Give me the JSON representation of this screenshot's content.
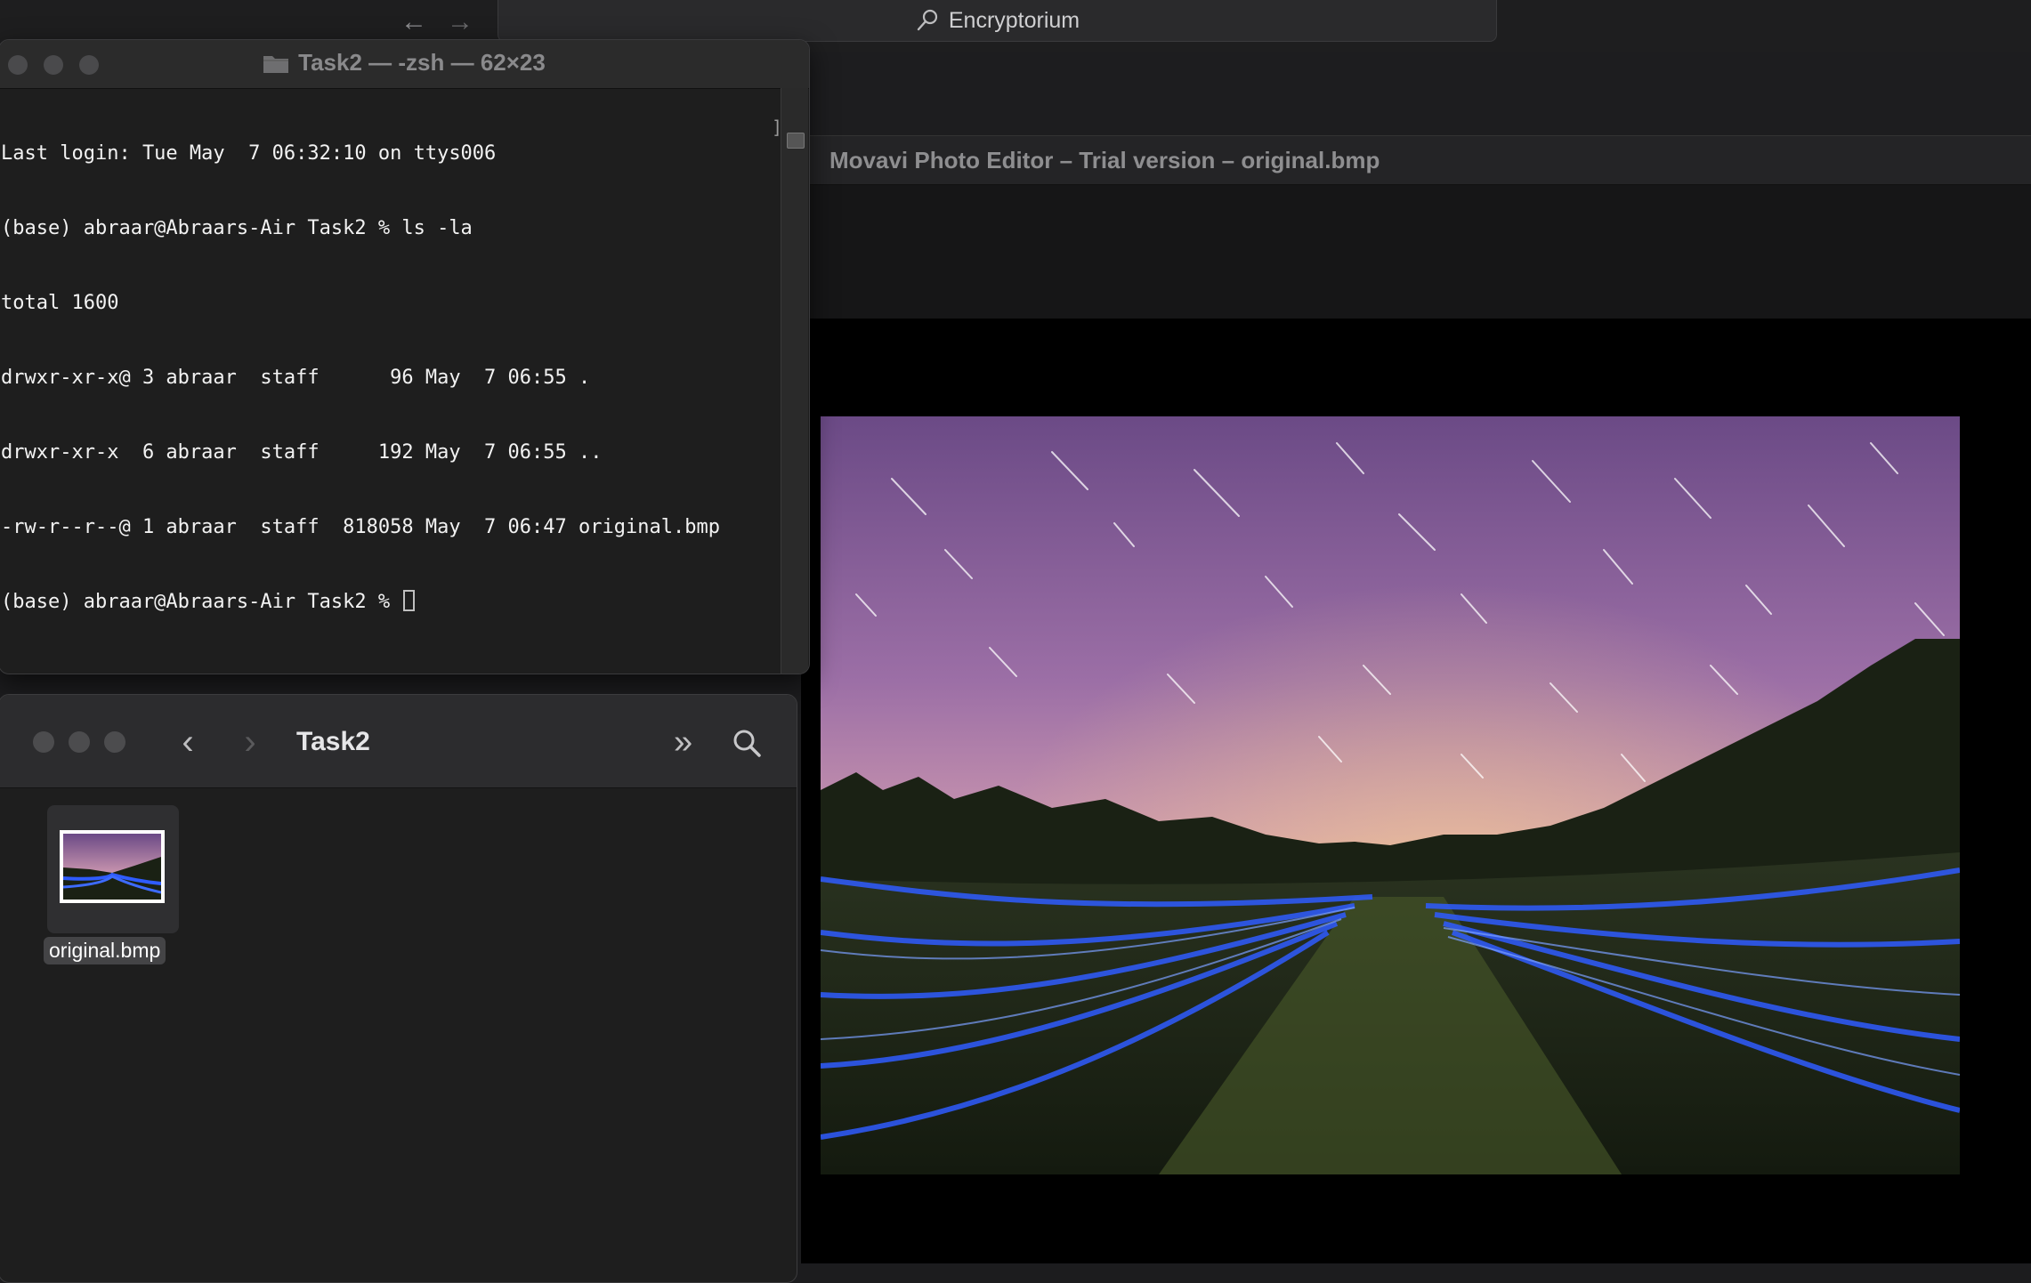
{
  "topbar": {
    "back_glyph": "←",
    "forward_glyph": "→",
    "address_text": "Encryptorium",
    "address_icon": "search-icon"
  },
  "editor": {
    "window_title": "Movavi Photo Editor – Trial version – original.bmp"
  },
  "terminal": {
    "title": "Task2 — -zsh — 62×23",
    "lines": [
      "Last login: Tue May  7 06:32:10 on ttys006",
      "(base) abraar@Abraars-Air Task2 % ls -la",
      "total 1600",
      "drwxr-xr-x@ 3 abraar  staff      96 May  7 06:55 .",
      "drwxr-xr-x  6 abraar  staff     192 May  7 06:55 ..",
      "-rw-r--r--@ 1 abraar  staff  818058 May  7 06:47 original.bmp",
      "(base) abraar@Abraars-Air Task2 % "
    ],
    "scroll_bracket": "]"
  },
  "finder": {
    "title": "Task2",
    "back_glyph": "‹",
    "forward_glyph": "›",
    "more_glyph": "»",
    "files": [
      {
        "name": "original.bmp"
      }
    ]
  },
  "colors": {
    "window_bg": "#1e1e1e",
    "titlebar": "#2b2b2b",
    "light_trail_blue": "#2f5cff"
  }
}
